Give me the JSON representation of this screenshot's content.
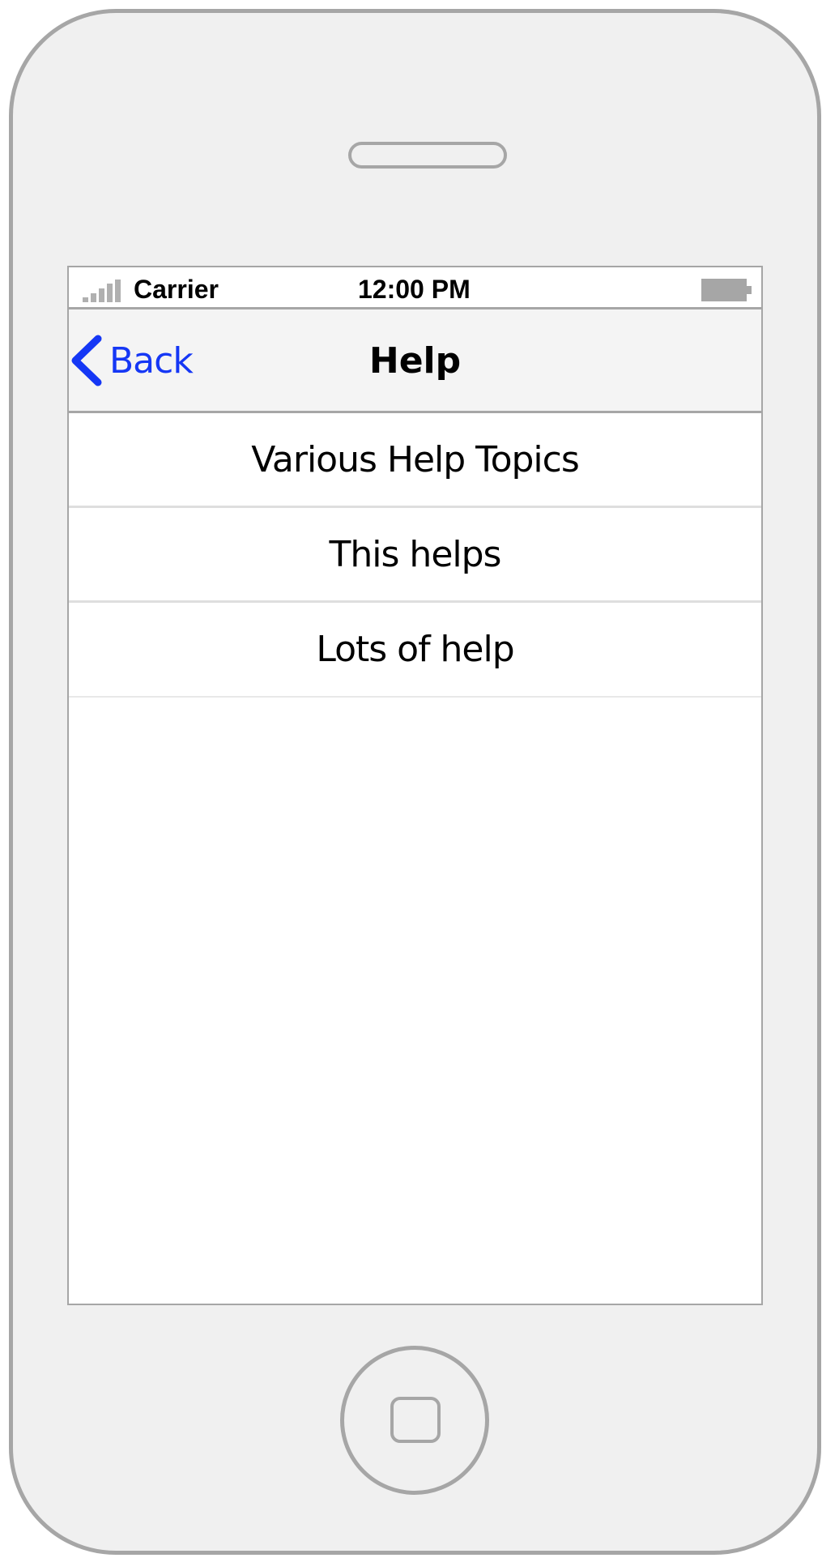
{
  "status_bar": {
    "carrier": "Carrier",
    "time": "12:00 PM",
    "signal_icon": "signal-bars-icon",
    "battery_icon": "battery-icon"
  },
  "nav_bar": {
    "back_label": "Back",
    "back_icon": "chevron-left-icon",
    "title": "Help"
  },
  "help_list": {
    "items": [
      {
        "label": "Various Help Topics"
      },
      {
        "label": "This helps"
      },
      {
        "label": "Lots of help"
      }
    ]
  },
  "colors": {
    "accent": "#1537f5",
    "frame": "#a6a6a6",
    "phone_body": "#f0f0f0",
    "nav_background": "#f4f4f4",
    "divider": "#dedede"
  }
}
